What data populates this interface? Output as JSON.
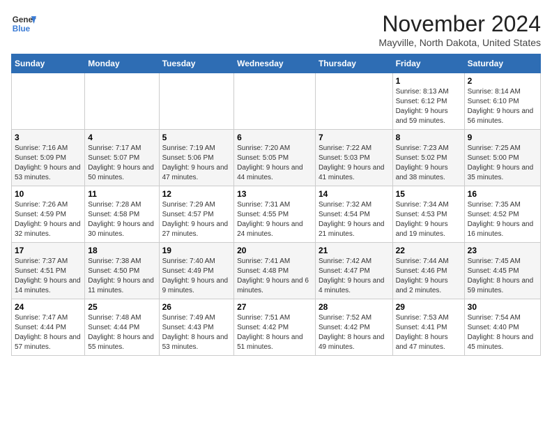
{
  "header": {
    "logo_line1": "General",
    "logo_line2": "Blue",
    "main_title": "November 2024",
    "subtitle": "Mayville, North Dakota, United States"
  },
  "days_of_week": [
    "Sunday",
    "Monday",
    "Tuesday",
    "Wednesday",
    "Thursday",
    "Friday",
    "Saturday"
  ],
  "weeks": [
    [
      {
        "day": "",
        "info": ""
      },
      {
        "day": "",
        "info": ""
      },
      {
        "day": "",
        "info": ""
      },
      {
        "day": "",
        "info": ""
      },
      {
        "day": "",
        "info": ""
      },
      {
        "day": "1",
        "info": "Sunrise: 8:13 AM\nSunset: 6:12 PM\nDaylight: 9 hours and 59 minutes."
      },
      {
        "day": "2",
        "info": "Sunrise: 8:14 AM\nSunset: 6:10 PM\nDaylight: 9 hours and 56 minutes."
      }
    ],
    [
      {
        "day": "3",
        "info": "Sunrise: 7:16 AM\nSunset: 5:09 PM\nDaylight: 9 hours and 53 minutes."
      },
      {
        "day": "4",
        "info": "Sunrise: 7:17 AM\nSunset: 5:07 PM\nDaylight: 9 hours and 50 minutes."
      },
      {
        "day": "5",
        "info": "Sunrise: 7:19 AM\nSunset: 5:06 PM\nDaylight: 9 hours and 47 minutes."
      },
      {
        "day": "6",
        "info": "Sunrise: 7:20 AM\nSunset: 5:05 PM\nDaylight: 9 hours and 44 minutes."
      },
      {
        "day": "7",
        "info": "Sunrise: 7:22 AM\nSunset: 5:03 PM\nDaylight: 9 hours and 41 minutes."
      },
      {
        "day": "8",
        "info": "Sunrise: 7:23 AM\nSunset: 5:02 PM\nDaylight: 9 hours and 38 minutes."
      },
      {
        "day": "9",
        "info": "Sunrise: 7:25 AM\nSunset: 5:00 PM\nDaylight: 9 hours and 35 minutes."
      }
    ],
    [
      {
        "day": "10",
        "info": "Sunrise: 7:26 AM\nSunset: 4:59 PM\nDaylight: 9 hours and 32 minutes."
      },
      {
        "day": "11",
        "info": "Sunrise: 7:28 AM\nSunset: 4:58 PM\nDaylight: 9 hours and 30 minutes."
      },
      {
        "day": "12",
        "info": "Sunrise: 7:29 AM\nSunset: 4:57 PM\nDaylight: 9 hours and 27 minutes."
      },
      {
        "day": "13",
        "info": "Sunrise: 7:31 AM\nSunset: 4:55 PM\nDaylight: 9 hours and 24 minutes."
      },
      {
        "day": "14",
        "info": "Sunrise: 7:32 AM\nSunset: 4:54 PM\nDaylight: 9 hours and 21 minutes."
      },
      {
        "day": "15",
        "info": "Sunrise: 7:34 AM\nSunset: 4:53 PM\nDaylight: 9 hours and 19 minutes."
      },
      {
        "day": "16",
        "info": "Sunrise: 7:35 AM\nSunset: 4:52 PM\nDaylight: 9 hours and 16 minutes."
      }
    ],
    [
      {
        "day": "17",
        "info": "Sunrise: 7:37 AM\nSunset: 4:51 PM\nDaylight: 9 hours and 14 minutes."
      },
      {
        "day": "18",
        "info": "Sunrise: 7:38 AM\nSunset: 4:50 PM\nDaylight: 9 hours and 11 minutes."
      },
      {
        "day": "19",
        "info": "Sunrise: 7:40 AM\nSunset: 4:49 PM\nDaylight: 9 hours and 9 minutes."
      },
      {
        "day": "20",
        "info": "Sunrise: 7:41 AM\nSunset: 4:48 PM\nDaylight: 9 hours and 6 minutes."
      },
      {
        "day": "21",
        "info": "Sunrise: 7:42 AM\nSunset: 4:47 PM\nDaylight: 9 hours and 4 minutes."
      },
      {
        "day": "22",
        "info": "Sunrise: 7:44 AM\nSunset: 4:46 PM\nDaylight: 9 hours and 2 minutes."
      },
      {
        "day": "23",
        "info": "Sunrise: 7:45 AM\nSunset: 4:45 PM\nDaylight: 8 hours and 59 minutes."
      }
    ],
    [
      {
        "day": "24",
        "info": "Sunrise: 7:47 AM\nSunset: 4:44 PM\nDaylight: 8 hours and 57 minutes."
      },
      {
        "day": "25",
        "info": "Sunrise: 7:48 AM\nSunset: 4:44 PM\nDaylight: 8 hours and 55 minutes."
      },
      {
        "day": "26",
        "info": "Sunrise: 7:49 AM\nSunset: 4:43 PM\nDaylight: 8 hours and 53 minutes."
      },
      {
        "day": "27",
        "info": "Sunrise: 7:51 AM\nSunset: 4:42 PM\nDaylight: 8 hours and 51 minutes."
      },
      {
        "day": "28",
        "info": "Sunrise: 7:52 AM\nSunset: 4:42 PM\nDaylight: 8 hours and 49 minutes."
      },
      {
        "day": "29",
        "info": "Sunrise: 7:53 AM\nSunset: 4:41 PM\nDaylight: 8 hours and 47 minutes."
      },
      {
        "day": "30",
        "info": "Sunrise: 7:54 AM\nSunset: 4:40 PM\nDaylight: 8 hours and 45 minutes."
      }
    ]
  ]
}
